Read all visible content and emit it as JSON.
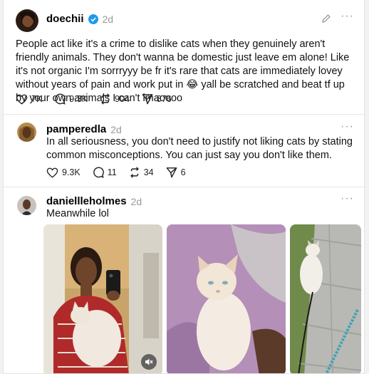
{
  "posts": [
    {
      "username": "doechii",
      "verified": true,
      "time": "2d",
      "text": "People act like it's a crime to dislike cats when they genuinely aren't friendly animals. They don't wanna be domestic just leave em alone! Like it's not organic I'm sorrryyy be fr it's rare that cats are immediately lovey without years of pain and work put in 😂 yall be scratched and beat tf up by your own animals I can't lmaoooo",
      "likes": "7K",
      "replies": "9.3K",
      "reposts": "904",
      "shares": "876"
    },
    {
      "username": "pamperedla",
      "time": "2d",
      "text": "In all seriousness, you don't need to justify not liking cats by stating common misconceptions. You can just say you don't like them.",
      "likes": "9.3K",
      "replies": "11",
      "reposts": "34",
      "shares": "6"
    },
    {
      "username": "daniellleholmes",
      "time": "2d",
      "text": "Meanwhile lol"
    }
  ],
  "icons": {
    "like": "heart-icon",
    "reply": "comment-icon",
    "repost": "repost-icon",
    "share": "send-icon",
    "menu": "more-icon",
    "edit": "pencil-icon",
    "mute": "mute-icon"
  },
  "colors": {
    "verified": "#1d9bf0",
    "muted_text": "#999999",
    "divider": "#e6e6e6"
  }
}
